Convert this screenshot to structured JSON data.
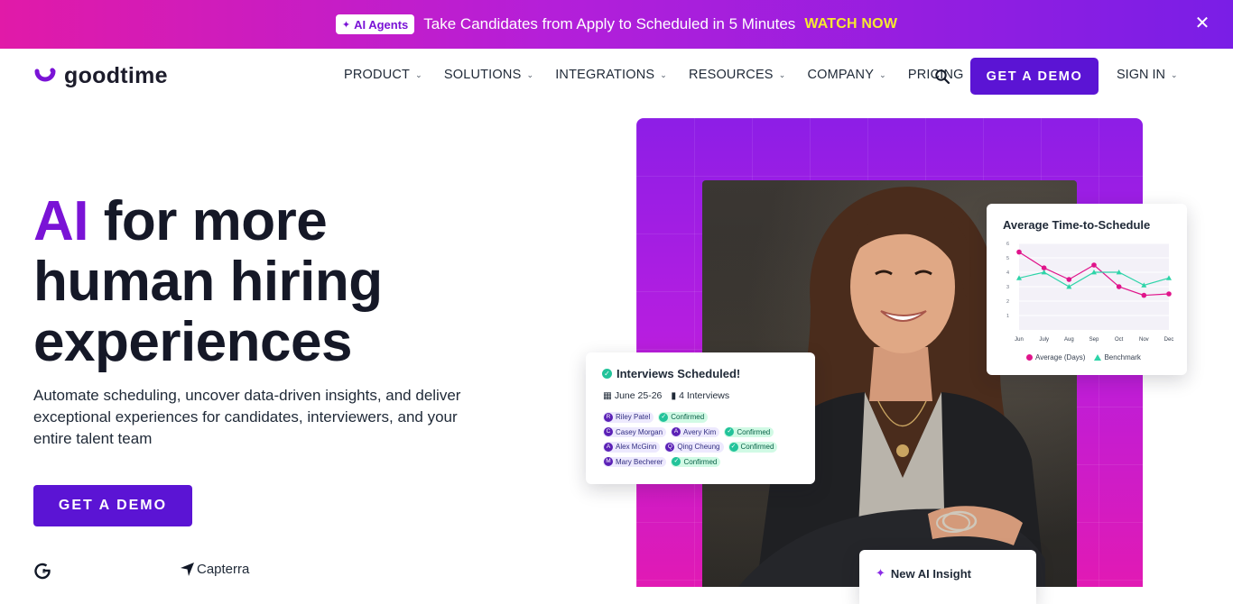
{
  "announcement": {
    "badge": "AI Agents",
    "message": "Take Candidates from Apply to Scheduled in 5 Minutes",
    "cta": "WATCH NOW",
    "close_icon": "close-icon"
  },
  "nav": {
    "logo_text": "goodtime",
    "items": [
      {
        "label": "PRODUCT",
        "has_dropdown": true
      },
      {
        "label": "SOLUTIONS",
        "has_dropdown": true
      },
      {
        "label": "INTEGRATIONS",
        "has_dropdown": true
      },
      {
        "label": "RESOURCES",
        "has_dropdown": true
      },
      {
        "label": "COMPANY",
        "has_dropdown": true
      },
      {
        "label": "PRICING",
        "has_dropdown": false
      }
    ],
    "demo_button": "GET A DEMO",
    "sign_in": "SIGN IN"
  },
  "hero": {
    "title_accent": "AI",
    "title_rest_line1": " for more",
    "title_line2": "human hiring",
    "title_line3": "experiences",
    "subtitle": "Automate scheduling, uncover data-driven insights, and deliver exceptional experiences for candidates, interviewers, and your entire talent team",
    "demo_button": "GET A DEMO",
    "review_brands": [
      "G2",
      "Capterra"
    ]
  },
  "chart_card": {
    "title": "Average Time-to-Schedule",
    "legend_average": "Average (Days)",
    "legend_benchmark": "Benchmark"
  },
  "chart_data": {
    "type": "line",
    "x": [
      "Jun",
      "July",
      "Aug",
      "Sep",
      "Oct",
      "Nov",
      "Dec"
    ],
    "ylim": [
      0,
      6
    ],
    "yticks": [
      1,
      2,
      3,
      4,
      5,
      6
    ],
    "series": [
      {
        "name": "Average (Days)",
        "values": [
          5.4,
          4.3,
          3.5,
          4.5,
          3.0,
          2.4,
          2.5
        ],
        "color": "#e0148b"
      },
      {
        "name": "Benchmark",
        "values": [
          3.6,
          4.0,
          3.0,
          4.0,
          4.0,
          3.1,
          3.6
        ],
        "color": "#2dd4a8"
      }
    ]
  },
  "interviews_card": {
    "title": "Interviews Scheduled!",
    "dates": "June 25-26",
    "count": "4 Interviews",
    "rows": [
      [
        {
          "initial": "R",
          "name": "Riley Patel"
        },
        {
          "status": "Confirmed"
        }
      ],
      [
        {
          "initial": "C",
          "name": "Casey Morgan"
        },
        {
          "initial": "A",
          "name": "Avery Kim"
        },
        {
          "status": "Confirmed"
        }
      ],
      [
        {
          "initial": "A",
          "name": "Alex McGinn"
        },
        {
          "initial": "Q",
          "name": "Qing Cheung"
        },
        {
          "status": "Confirmed"
        }
      ],
      [
        {
          "initial": "M",
          "name": "Mary Becherer"
        },
        {
          "status": "Confirmed"
        }
      ]
    ]
  },
  "ai_card": {
    "title": "New AI Insight"
  },
  "colors": {
    "brand_purple": "#5b14d4",
    "accent_violet": "#7a13d6",
    "banner_gradient_start": "#e11aa8",
    "banner_gradient_end": "#7a1ee6",
    "watch_now_yellow": "#f6e930"
  }
}
